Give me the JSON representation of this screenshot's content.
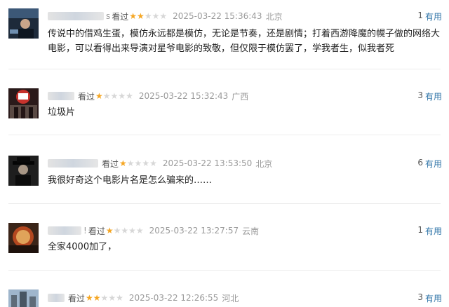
{
  "comments": [
    {
      "username_suffix": "s",
      "watched_label": "看过",
      "rating": 2,
      "time": "2025-03-22 15:36:43",
      "location": "北京",
      "helpful_count": "1",
      "helpful_label": "有用",
      "text": "传说中的借鸡生蛋，模仿永远都是模仿，无论是节奏，还是剧情；打着西游降魔的幌子做的网络大电影，可以看得出来导演对星爷电影的致敬，但仅限于模仿罢了，学我者生，似我者死"
    },
    {
      "username_suffix": "",
      "watched_label": "看过",
      "rating": 1,
      "time": "2025-03-22 15:32:43",
      "location": "广西",
      "helpful_count": "3",
      "helpful_label": "有用",
      "text": "垃圾片"
    },
    {
      "username_suffix": "",
      "watched_label": "看过",
      "rating": 1,
      "time": "2025-03-22 13:53:50",
      "location": "北京",
      "helpful_count": "6",
      "helpful_label": "有用",
      "text": "我很好奇这个电影片名是怎么骗来的……"
    },
    {
      "username_suffix": "!",
      "watched_label": "看过",
      "rating": 1,
      "time": "2025-03-22 13:27:57",
      "location": "云南",
      "helpful_count": "1",
      "helpful_label": "有用",
      "text": "全家4000加了，"
    },
    {
      "username_suffix": "",
      "watched_label": "看过",
      "rating": 2,
      "time": "2025-03-22 12:26:55",
      "location": "河北",
      "helpful_count": "3",
      "helpful_label": "有用",
      "text": ""
    }
  ],
  "max_rating": 5
}
